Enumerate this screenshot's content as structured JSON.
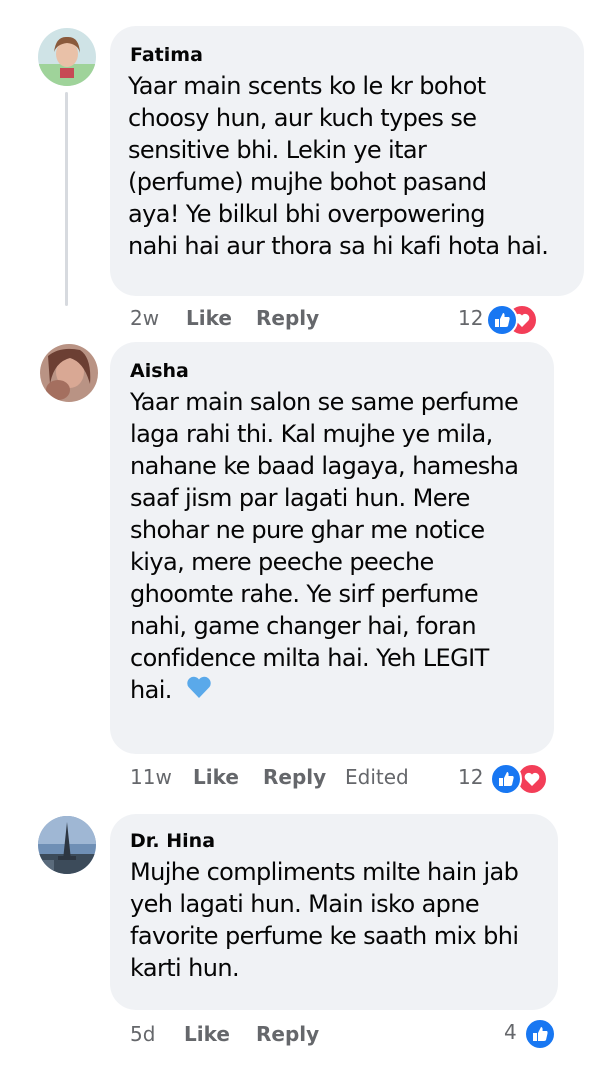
{
  "comments": [
    {
      "author": "Fatima",
      "lines": [
        "Yaar main scents ko le kr bohot",
        "choosy hun, aur kuch types se",
        "sensitive bhi. Lekin ye itar",
        "(perfume) mujhe bohot pasand",
        "aya! Ye bilkul bhi overpowering",
        "nahi hai aur thora sa hi kafi hota hai."
      ],
      "time": "2w",
      "like_label": "Like",
      "reply_label": "Reply",
      "reaction_count": "12"
    },
    {
      "author": "Aisha",
      "lines": [
        "Yaar main salon se same perfume",
        "laga rahi thi. Kal mujhe ye mila,",
        "nahane ke baad lagaya, hamesha",
        "saaf jism par lagati hun. Mere",
        "shohar ne pure ghar me notice",
        "kiya, mere peeche peeche",
        "ghoomte rahe. Ye sirf perfume",
        "nahi, game changer hai, foran",
        "confidence milta hai. Yeh LEGIT",
        "hai."
      ],
      "time": "11w",
      "like_label": "Like",
      "reply_label": "Reply",
      "edited_label": "Edited",
      "reaction_count": "12"
    },
    {
      "author": "Dr. Hina",
      "lines": [
        "Mujhe compliments milte hain jab",
        "yeh lagati hun. Main isko apne",
        "favorite perfume ke saath mix bhi",
        "karti hun."
      ],
      "time": "5d",
      "like_label": "Like",
      "reply_label": "Reply",
      "reaction_count": "4"
    }
  ],
  "colors": {
    "bubble": "#f0f2f5",
    "meta": "#65676b",
    "like": "#1877f2",
    "love": "#f33e58",
    "heart": "#5aa9ea"
  }
}
